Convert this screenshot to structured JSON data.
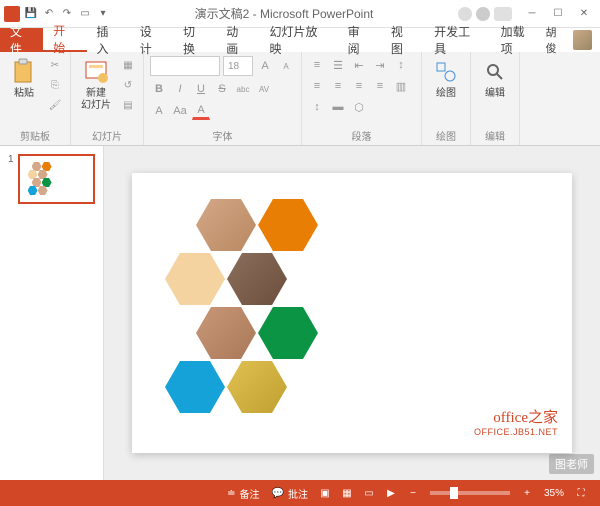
{
  "titlebar": {
    "doc_title": "演示文稿2 - Microsoft PowerPoint",
    "user_name": "胡俊"
  },
  "tabs": {
    "file": "文件",
    "home": "开始",
    "insert": "插入",
    "design": "设计",
    "transitions": "切换",
    "animations": "动画",
    "slideshow": "幻灯片放映",
    "review": "审阅",
    "view": "视图",
    "developer": "开发工具",
    "addins": "加载项"
  },
  "ribbon": {
    "clipboard": {
      "label": "剪贴板",
      "paste": "粘贴"
    },
    "slides": {
      "label": "幻灯片",
      "new_slide": "新建\n幻灯片"
    },
    "font": {
      "label": "字体",
      "size": "18",
      "bold": "B",
      "italic": "I",
      "underline": "U",
      "strike": "S",
      "shadow": "abc",
      "spacing": "AV",
      "case": "Aa"
    },
    "paragraph": {
      "label": "段落"
    },
    "drawing": {
      "label": "绘图",
      "btn": "绘图"
    },
    "editing": {
      "label": "编辑",
      "btn": "编辑"
    }
  },
  "thumb": {
    "num": "1"
  },
  "slide": {
    "watermark1": "office之家",
    "watermark2": "OFFICE.JB51.NET",
    "hex_colors": {
      "orange": "#e87e04",
      "tan": "#f4d3a1",
      "green": "#0b9444",
      "blue": "#15a2d8"
    }
  },
  "statusbar": {
    "notes": "备注",
    "comments": "批注",
    "zoom_pct": "35%"
  },
  "corner_watermark": "图老师"
}
